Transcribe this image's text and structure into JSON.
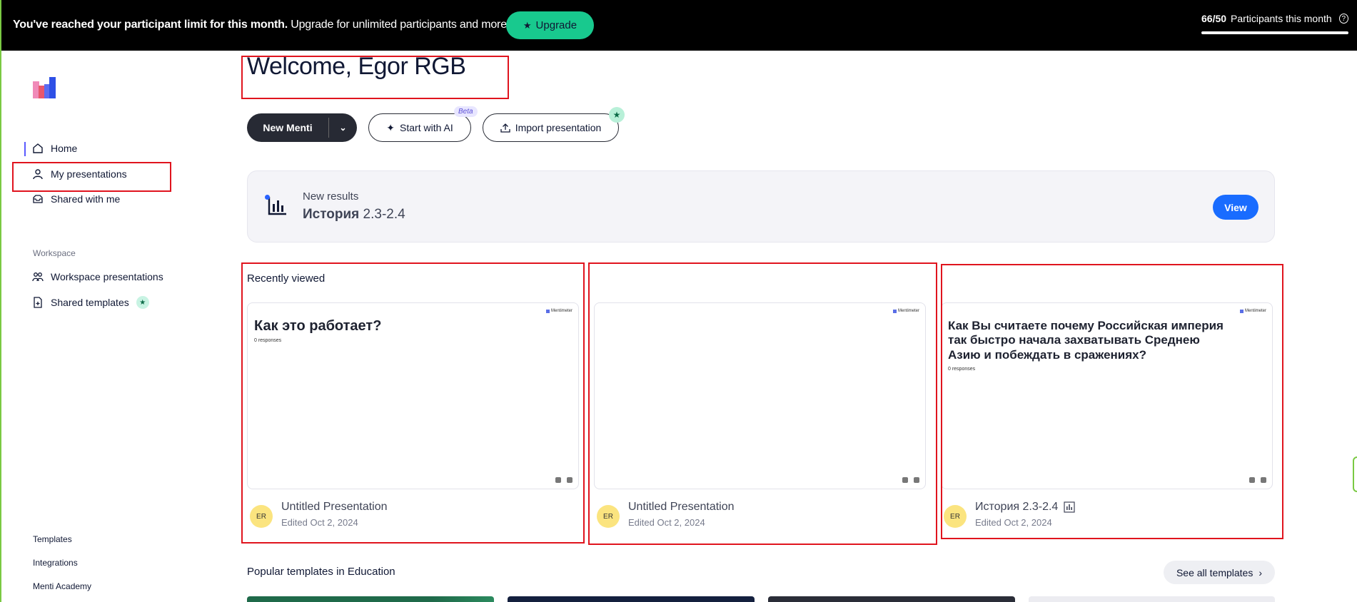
{
  "banner": {
    "message_bold": "You've reached your participant limit for this month.",
    "message_rest": " Upgrade for unlimited participants and more.",
    "upgrade_label": "Upgrade",
    "limit_count": "66/50",
    "limit_label": "Participants this month",
    "limit_progress": 1.0
  },
  "sidebar": {
    "nav": [
      {
        "label": "Home",
        "icon": "home-icon"
      },
      {
        "label": "My presentations",
        "icon": "user-icon"
      },
      {
        "label": "Shared with me",
        "icon": "inbox-icon"
      }
    ],
    "workspace_label": "Workspace",
    "workspace_nav": [
      {
        "label": "Workspace presentations",
        "icon": "group-icon"
      },
      {
        "label": "Shared templates",
        "icon": "template-icon"
      }
    ],
    "bottom_links": [
      "Templates",
      "Integrations",
      "Menti Academy"
    ]
  },
  "main": {
    "welcome": "Welcome, Egor RGB",
    "new_menti_label": "New Menti",
    "start_ai_label": "Start with AI",
    "beta_label": "Beta",
    "import_label": "Import presentation",
    "results": {
      "label": "New results",
      "title_bold": "История",
      "title_rest": " 2.3-2.4",
      "view_label": "View"
    },
    "recently_viewed_title": "Recently viewed",
    "presentations": [
      {
        "question": "Как это работает?",
        "responses": "0 responses",
        "name": "Untitled Presentation",
        "edited": "Edited Oct 2, 2024",
        "avatar": "ER"
      },
      {
        "question": "",
        "responses": "",
        "name": "Untitled Presentation",
        "edited": "Edited Oct 2, 2024",
        "avatar": "ER"
      },
      {
        "question": "Как Вы считаете почему Российская империя так быстро начала захватывать Среднею Азию и побеждать в сражениях?",
        "responses": "0 responses",
        "name": "История 2.3-2.4",
        "edited": "Edited Oct 2, 2024",
        "avatar": "ER"
      }
    ],
    "thumb_brand": "Mentimeter",
    "popular_title": "Popular templates in Education",
    "see_all_label": "See all templates"
  },
  "colors": {
    "accent_green": "#18c98e",
    "view_blue": "#196cff",
    "dark": "#272a34",
    "highlight_red": "#e0141e"
  }
}
